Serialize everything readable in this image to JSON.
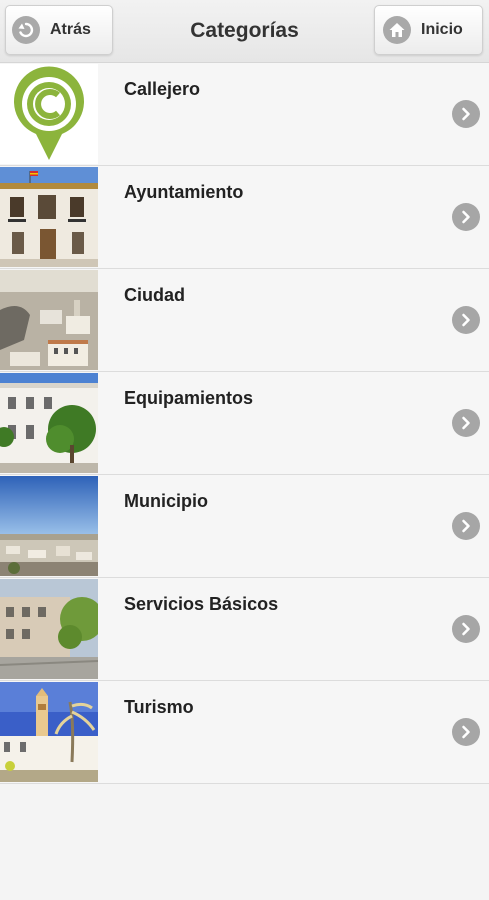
{
  "header": {
    "title": "Categorías",
    "back_label": "Atrás",
    "home_label": "Inicio"
  },
  "categories": [
    {
      "label": "Callejero",
      "icon": "callejero-logo"
    },
    {
      "label": "Ayuntamiento",
      "icon": "ayuntamiento-photo"
    },
    {
      "label": "Ciudad",
      "icon": "ciudad-photo"
    },
    {
      "label": "Equipamientos",
      "icon": "equipamientos-photo"
    },
    {
      "label": "Municipio",
      "icon": "municipio-photo"
    },
    {
      "label": "Servicios Básicos",
      "icon": "servicios-basicos-photo"
    },
    {
      "label": "Turismo",
      "icon": "turismo-photo"
    }
  ],
  "colors": {
    "header_bg": "#e9e9e9",
    "row_bg": "#f6f6f6",
    "chevron_bg": "#a6a6a6",
    "logo_green": "#8cb43c"
  }
}
